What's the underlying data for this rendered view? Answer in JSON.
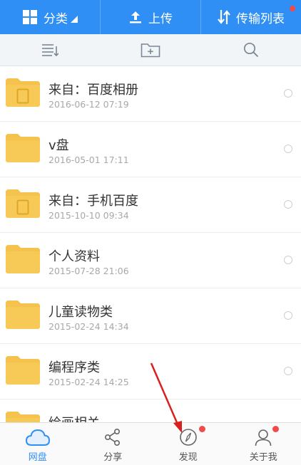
{
  "topbar": {
    "category_label": "分类",
    "upload_label": "上传",
    "transfer_label": "传输列表"
  },
  "files": [
    {
      "name": "来自：百度相册",
      "date": "2016-06-12  07:19",
      "icon": "folder-photo-icon"
    },
    {
      "name": "v盘",
      "date": "2016-05-01  17:11",
      "icon": "folder-icon"
    },
    {
      "name": "来自：手机百度",
      "date": "2015-10-10  09:34",
      "icon": "folder-phone-icon"
    },
    {
      "name": "个人资料",
      "date": "2015-07-28  21:06",
      "icon": "folder-icon"
    },
    {
      "name": "儿童读物类",
      "date": "2015-02-24  14:34",
      "icon": "folder-icon"
    },
    {
      "name": "编程序类",
      "date": "2015-02-24  14:25",
      "icon": "folder-icon"
    },
    {
      "name": "绘画相关",
      "date": "",
      "icon": "folder-icon"
    }
  ],
  "bottom_nav": [
    {
      "label": "网盘",
      "icon": "cloud-icon",
      "active": true
    },
    {
      "label": "分享",
      "icon": "share-icon",
      "active": false
    },
    {
      "label": "发现",
      "icon": "compass-icon",
      "active": false
    },
    {
      "label": "关于我",
      "icon": "person-icon",
      "active": false
    }
  ],
  "colors": {
    "accent": "#2f8ff5",
    "folder": "#f5c34d",
    "badge": "#f04a4a",
    "annotation_arrow": "#d9201f"
  }
}
